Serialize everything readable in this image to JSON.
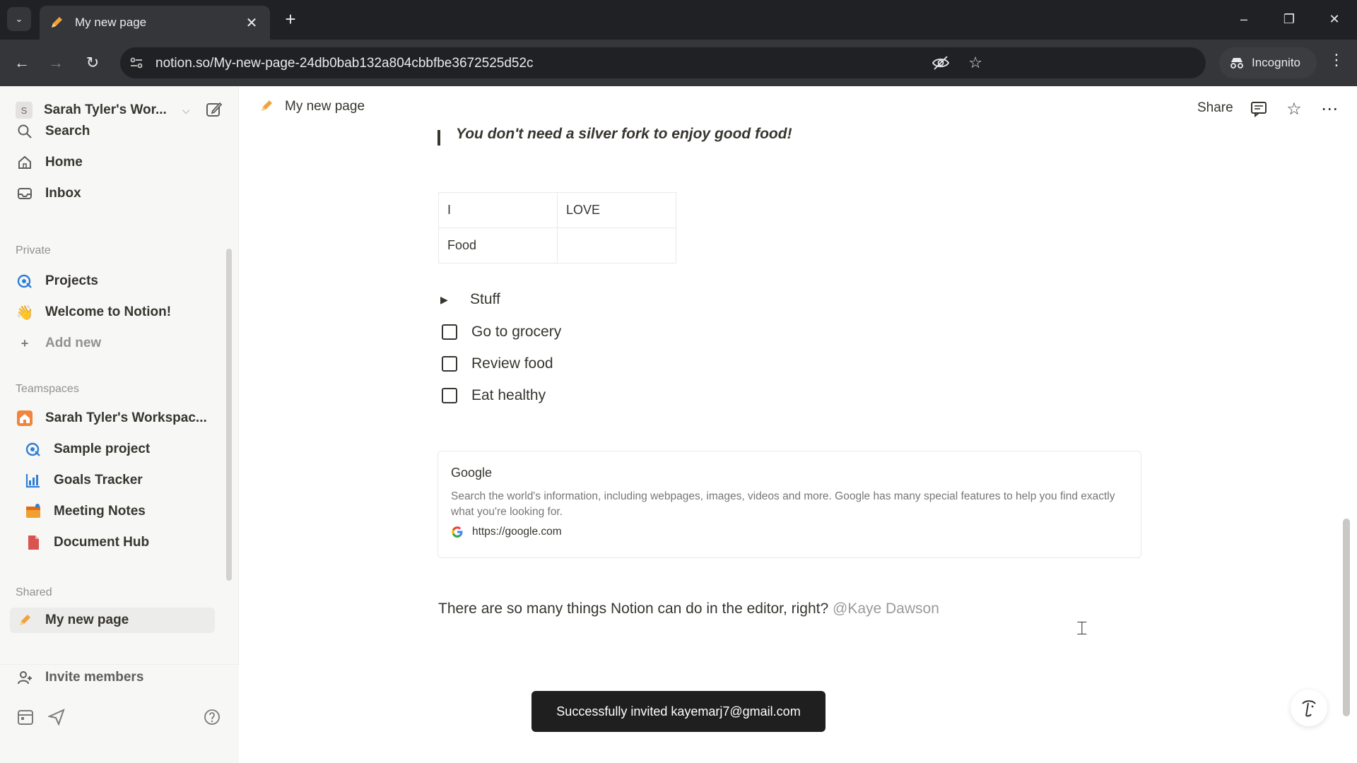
{
  "browser": {
    "tab_title": "My new page",
    "url": "notion.so/My-new-page-24db0bab132a804cbbfbe3672525d52c",
    "incognito_label": "Incognito"
  },
  "sidebar": {
    "workspace_name": "Sarah Tyler's Wor...",
    "workspace_initial": "S",
    "nav": [
      {
        "label": "Search",
        "icon": "search-icon"
      },
      {
        "label": "Home",
        "icon": "home-icon"
      },
      {
        "label": "Inbox",
        "icon": "inbox-icon"
      }
    ],
    "private_label": "Private",
    "private_items": [
      {
        "label": "Projects",
        "icon": "projects-icon"
      },
      {
        "label": "Welcome to Notion!",
        "icon": "wave-hand-icon"
      },
      {
        "label": "Add new",
        "icon": "plus-icon"
      }
    ],
    "teamspaces_label": "Teamspaces",
    "teamspace_name": "Sarah Tyler's Workspac...",
    "teamspace_items": [
      {
        "label": "Sample project",
        "icon": "projects-icon"
      },
      {
        "label": "Goals Tracker",
        "icon": "chart-icon"
      },
      {
        "label": "Meeting Notes",
        "icon": "calendar-icon"
      },
      {
        "label": "Document Hub",
        "icon": "document-icon"
      }
    ],
    "shared_label": "Shared",
    "shared_items": [
      {
        "label": "My new page",
        "icon": "pencil-icon"
      }
    ],
    "invite_label": "Invite members"
  },
  "page": {
    "breadcrumb": "My new page",
    "share_label": "Share",
    "quote": "You don't need a silver fork to enjoy good food!",
    "table": [
      [
        "I",
        "LOVE"
      ],
      [
        "Food",
        ""
      ]
    ],
    "toggle_label": "Stuff",
    "todos": [
      "Go to grocery",
      "Review food",
      "Eat healthy"
    ],
    "bookmark": {
      "title": "Google",
      "description": "Search the world's information, including webpages, images, videos and more. Google has many special features to help you find exactly what you're looking for.",
      "url": "https://google.com"
    },
    "paragraph": "There are so many things Notion can do in the editor, right? ",
    "mention": "@Kaye Dawson"
  },
  "toast": "Successfully invited kayemarj7@gmail.com",
  "colors": {
    "accent_orange": "#e16b16",
    "teamspace_icon": "#f0853b"
  }
}
